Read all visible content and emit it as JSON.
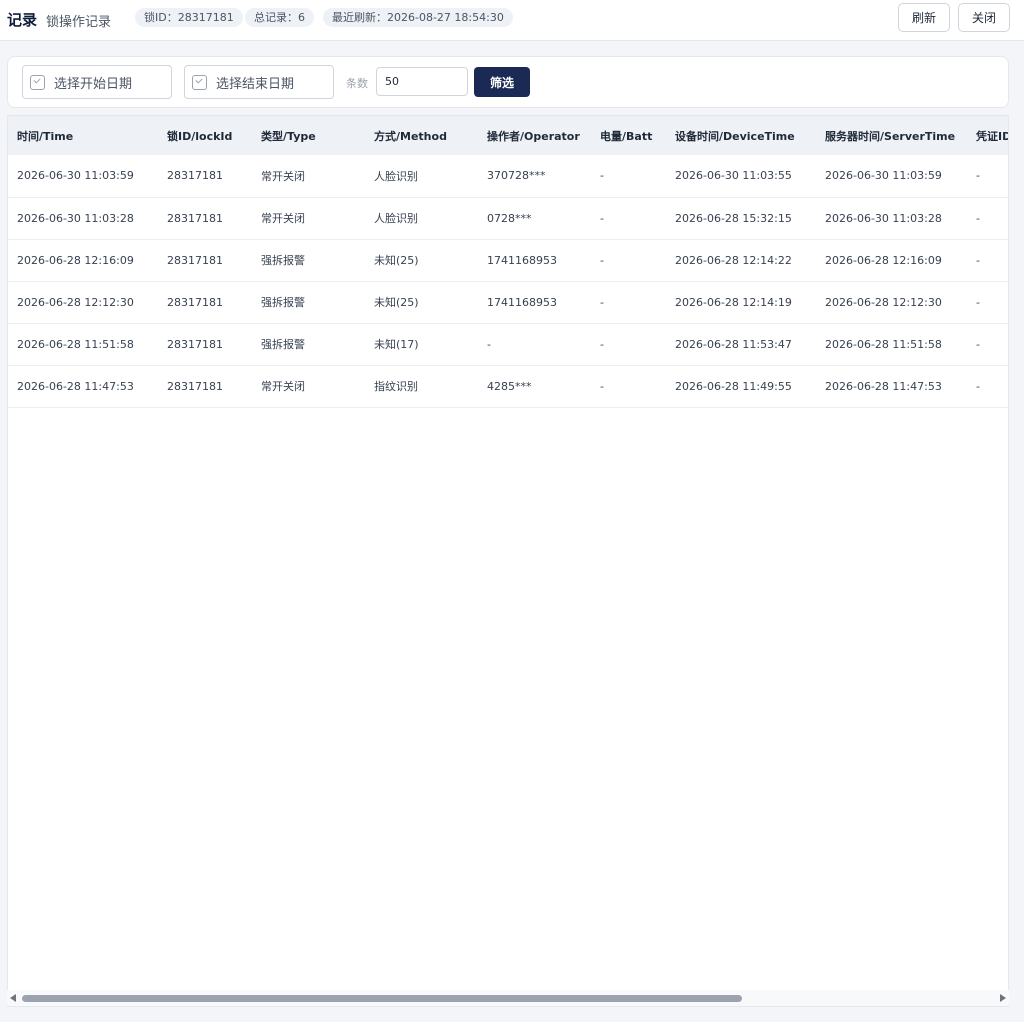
{
  "header": {
    "title": "记录",
    "subtitle": "锁操作记录",
    "badges": [
      "锁ID：28317181",
      "总记录：6",
      "最近刷新：2026-08-27 18:54:30"
    ],
    "refresh_label": "刷新",
    "close_label": "关闭"
  },
  "filter": {
    "start_date_placeholder": "选择开始日期",
    "end_date_placeholder": "选择结束日期",
    "count_label": "条数",
    "count_value": "50",
    "submit_label": "筛选"
  },
  "table": {
    "columns": [
      "时间/Time",
      "锁ID/lockId",
      "类型/Type",
      "方式/Method",
      "操作者/Operator",
      "电量/Batt",
      "设备时间/DeviceTime",
      "服务器时间/ServerTime",
      "凭证ID"
    ],
    "rows": [
      [
        "2026-06-30 11:03:59",
        "28317181",
        "常开关闭",
        "人脸识别",
        "370728***",
        "-",
        "2026-06-30 11:03:55",
        "2026-06-30 11:03:59",
        "-"
      ],
      [
        "2026-06-30 11:03:28",
        "28317181",
        "常开关闭",
        "人脸识别",
        "0728***",
        "-",
        "2026-06-28 15:32:15",
        "2026-06-30 11:03:28",
        "-"
      ],
      [
        "2026-06-28 12:16:09",
        "28317181",
        "强拆报警",
        "未知(25)",
        "1741168953",
        "-",
        "2026-06-28 12:14:22",
        "2026-06-28 12:16:09",
        "-"
      ],
      [
        "2026-06-28 12:12:30",
        "28317181",
        "强拆报警",
        "未知(25)",
        "1741168953",
        "-",
        "2026-06-28 12:14:19",
        "2026-06-28 12:12:30",
        "-"
      ],
      [
        "2026-06-28 11:51:58",
        "28317181",
        "强拆报警",
        "未知(17)",
        "-",
        "-",
        "2026-06-28 11:53:47",
        "2026-06-28 11:51:58",
        "-"
      ],
      [
        "2026-06-28 11:47:53",
        "28317181",
        "常开关闭",
        "指纹识别",
        "4285***",
        "-",
        "2026-06-28 11:49:55",
        "2026-06-28 11:47:53",
        "-"
      ]
    ]
  }
}
